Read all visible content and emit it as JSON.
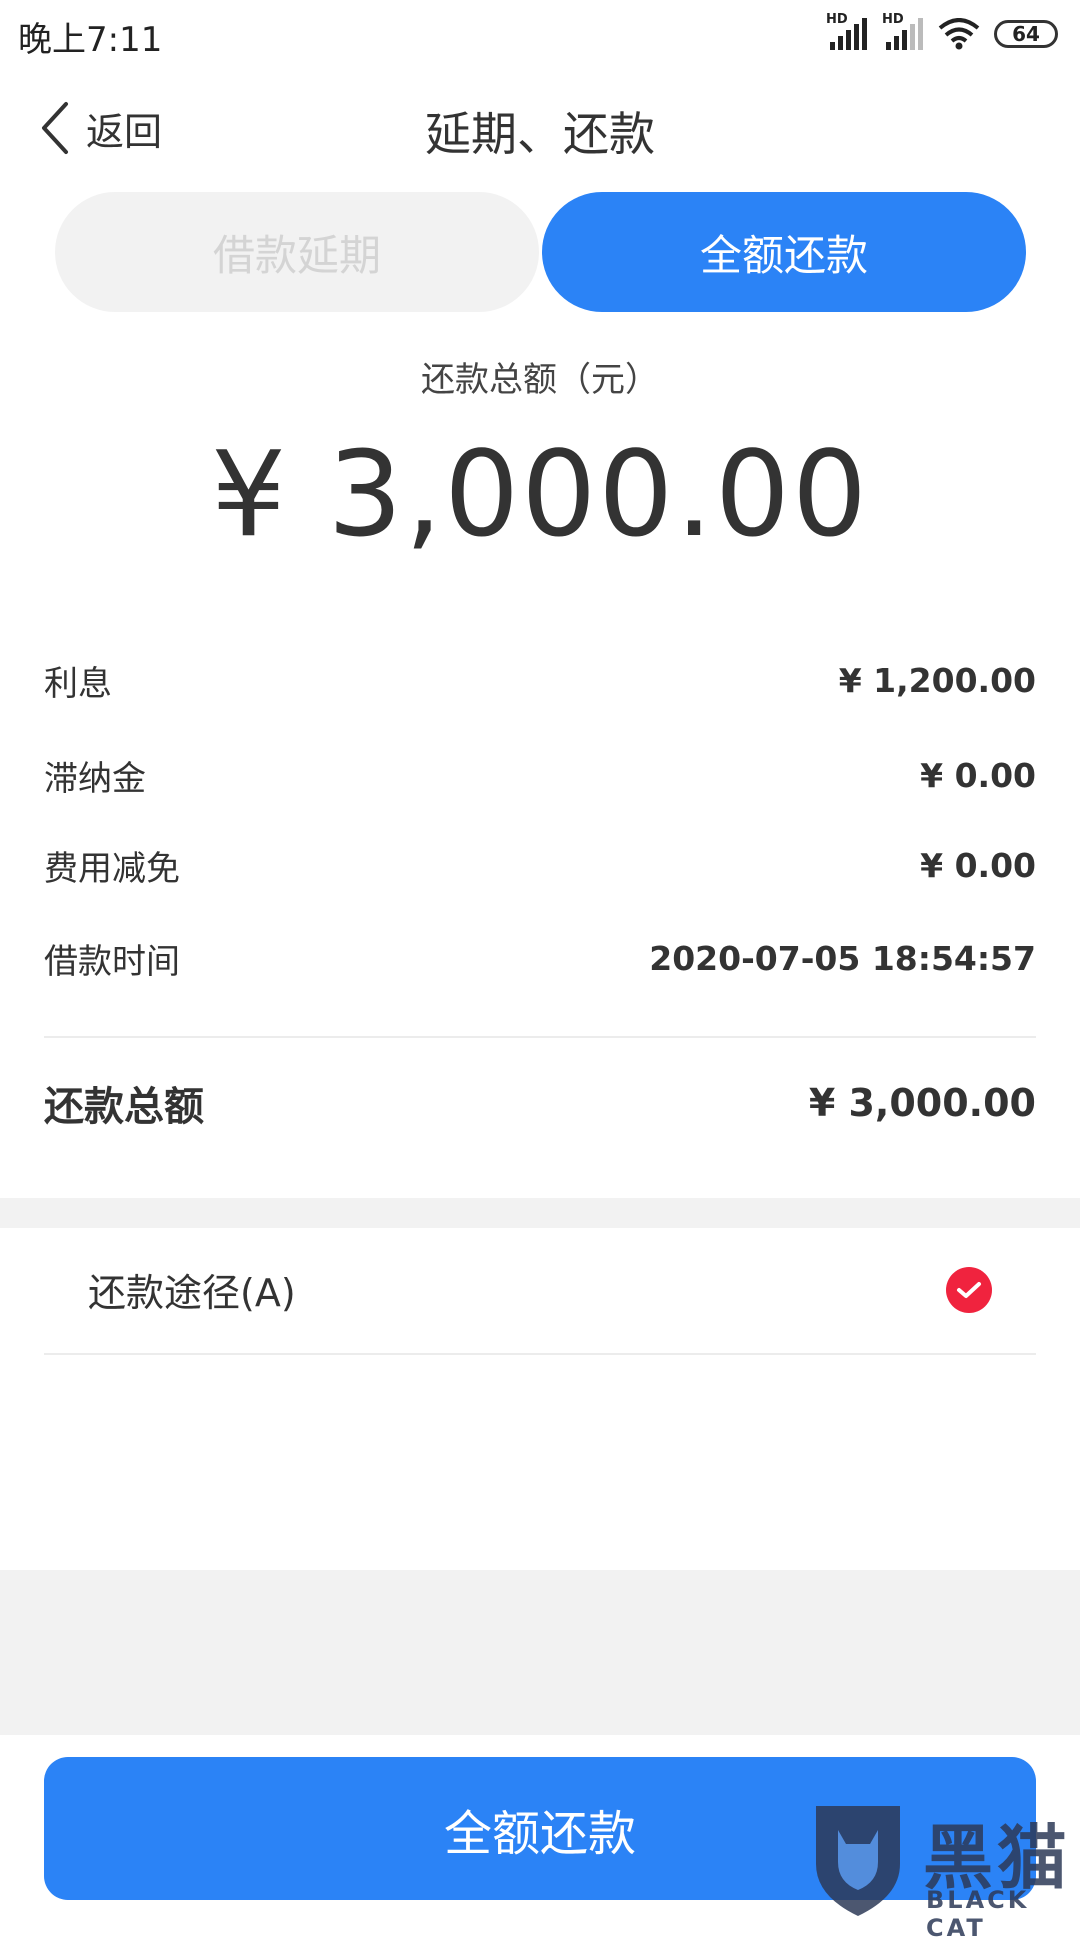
{
  "status_bar": {
    "time": "晚上7:11",
    "signal_label_1": "HD",
    "signal_label_2": "HD",
    "battery": "64"
  },
  "header": {
    "back_label": "返回",
    "title": "延期、还款"
  },
  "tabs": [
    {
      "label": "借款延期",
      "selected": false
    },
    {
      "label": "全额还款",
      "selected": true
    }
  ],
  "summary": {
    "label": "还款总额（元）",
    "amount": "¥ 3,000.00"
  },
  "details": [
    {
      "label": "利息",
      "value": "¥ 1,200.00"
    },
    {
      "label": "滞纳金",
      "value": "¥ 0.00"
    },
    {
      "label": "费用减免",
      "value": "¥ 0.00"
    },
    {
      "label": "借款时间",
      "value": "2020-07-05 18:54:57"
    }
  ],
  "total": {
    "label": "还款总额",
    "value": "¥ 3,000.00"
  },
  "payment_method": {
    "label": "还款途径(A)",
    "selected": true
  },
  "primary_button": {
    "label": "全额还款"
  },
  "watermark": {
    "text": "黑猫",
    "sub": "BLACK CAT"
  },
  "colors": {
    "accent": "#2b83f6",
    "check": "#f0233e",
    "inactive_tab_bg": "#f2f2f2",
    "inactive_tab_text": "#d4d4d4"
  }
}
